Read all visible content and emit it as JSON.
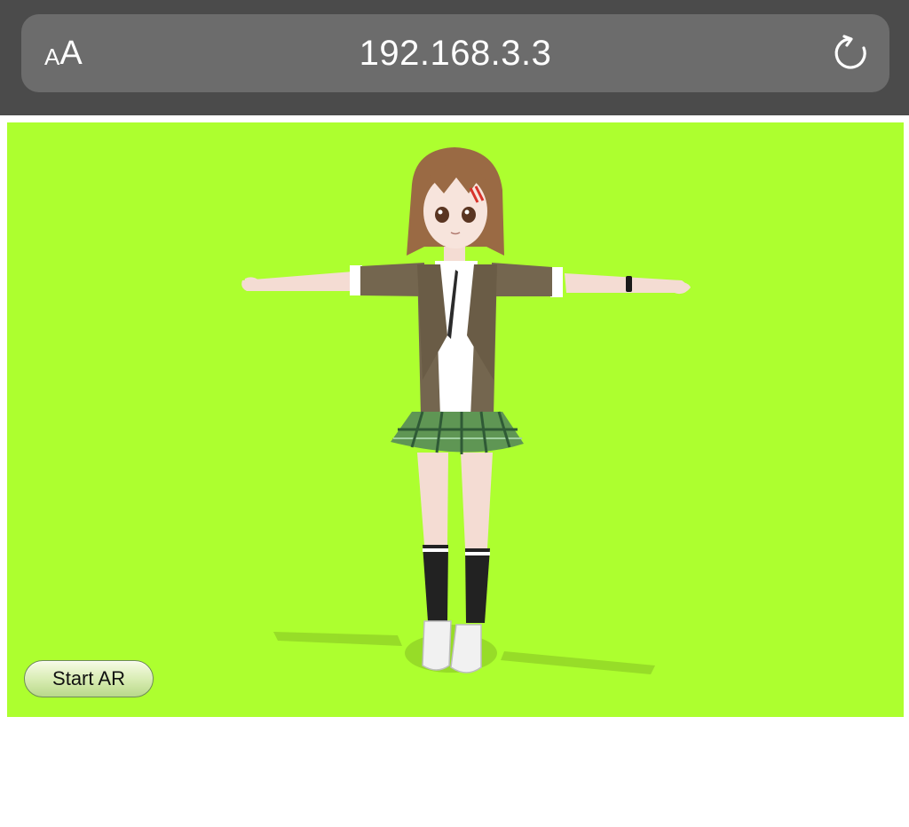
{
  "browser": {
    "text_size_small": "A",
    "text_size_large": "A",
    "url": "192.168.3.3",
    "reload_icon": "reload-icon",
    "bar_color": "#4b4b4b",
    "pill_color": "#6c6c6c"
  },
  "viewer": {
    "background_color": "#adff2f",
    "model": "anime-girl-t-pose",
    "start_ar_label": "Start AR"
  }
}
